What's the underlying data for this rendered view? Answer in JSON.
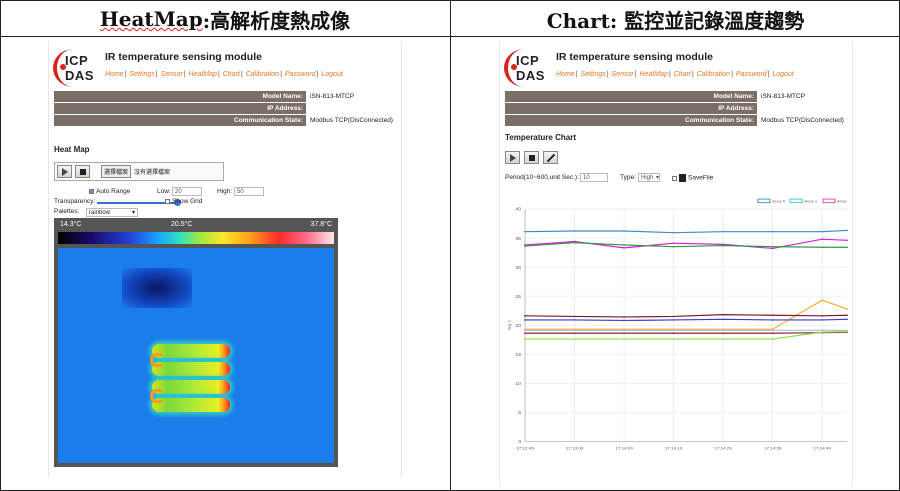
{
  "captions": {
    "left_prefix": "HeatMap",
    "left_suffix": ":高解析度熱成像",
    "right": "Chart:  監控並記錄溫度趨勢"
  },
  "common": {
    "logo_line1": "ICP",
    "logo_line2": "DAS",
    "module_title": "IR temperature sensing module",
    "nav": [
      "Home",
      "Settings",
      "Sensor",
      "HeatMap",
      "Chart",
      "Calibration",
      "Password",
      "Logout"
    ],
    "nav_sep": "|",
    "info": [
      {
        "key": "Model Name:",
        "value": "iSN-813-MTCP"
      },
      {
        "key": "IP Address:",
        "value": ""
      },
      {
        "key": "Communication State:",
        "value": "Modbus TCP(DisConnected)"
      }
    ]
  },
  "heatmap": {
    "section_title": "Heat Map",
    "file_button": "選擇檔案",
    "file_status": "沒有選擇檔案",
    "auto_range_label": "Auto Range",
    "auto_range_checked": true,
    "low_label": "Low:",
    "low_value": "20",
    "high_label": "High:",
    "high_value": "50",
    "transparency_label": "Transparency:",
    "show_grid_label": "Show Grid",
    "palettes_label": "Palettes:",
    "palette_value": "rainbow",
    "scale_min": "14.3°C",
    "scale_mid": "20.5°C",
    "scale_max": "37.8°C",
    "icons": [
      "play-icon",
      "stop-icon"
    ]
  },
  "chart_page": {
    "section_title": "Temperature Chart",
    "period_label": "Period(10~600,unit Sec.):",
    "period_value": "10",
    "type_label": "Type:",
    "type_value": "High",
    "savefile_label": "SaveFile",
    "icons": [
      "play-icon",
      "stop-icon",
      "brush-icon"
    ]
  },
  "chart_data": {
    "type": "line",
    "ylabel": "deg C",
    "ylim": [
      0,
      40
    ],
    "yticks": [
      0,
      5,
      10,
      15,
      20,
      25,
      30,
      35,
      40
    ],
    "x": [
      "17:12:49",
      "17:13:09",
      "17:14:09",
      "17:14:19",
      "17:14:29",
      "17:14:39",
      "17:14:49"
    ],
    "xtick_positions": [
      0,
      1,
      2,
      3,
      4,
      5,
      6
    ],
    "legend_placement": "top-right",
    "legend": [
      "Area 0",
      "Area 1",
      "Area"
    ],
    "series": [
      {
        "color": "#3a8ad0",
        "points": [
          [
            0,
            36.1
          ],
          [
            1,
            36.2
          ],
          [
            2,
            36.2
          ],
          [
            3,
            35.9
          ],
          [
            4,
            36.1
          ],
          [
            5,
            36.1
          ],
          [
            6,
            36.1
          ],
          [
            6.5,
            36.3
          ]
        ]
      },
      {
        "color": "#d020d8",
        "points": [
          [
            0,
            33.8
          ],
          [
            1,
            34.4
          ],
          [
            2,
            33.3
          ],
          [
            3,
            34.1
          ],
          [
            4,
            33.9
          ],
          [
            5,
            33.2
          ],
          [
            6,
            34.8
          ],
          [
            6.5,
            34.6
          ]
        ]
      },
      {
        "color": "#2a9a3a",
        "points": [
          [
            0,
            33.6
          ],
          [
            1,
            34.2
          ],
          [
            2,
            33.8
          ],
          [
            3,
            33.5
          ],
          [
            4,
            33.7
          ],
          [
            5,
            33.5
          ],
          [
            6,
            33.4
          ],
          [
            6.5,
            33.4
          ]
        ]
      },
      {
        "color": "#f0b030",
        "points": [
          [
            0,
            19.3
          ],
          [
            1,
            19.3
          ],
          [
            2,
            19.3
          ],
          [
            3,
            19.3
          ],
          [
            4,
            19.3
          ],
          [
            5,
            19.3
          ],
          [
            6,
            24.3
          ],
          [
            6.5,
            22.8
          ]
        ]
      },
      {
        "color": "#7a1a2a",
        "points": [
          [
            0,
            21.6
          ],
          [
            1,
            21.5
          ],
          [
            2,
            21.4
          ],
          [
            3,
            21.5
          ],
          [
            4,
            21.8
          ],
          [
            5,
            21.7
          ],
          [
            6,
            21.6
          ],
          [
            6.5,
            21.7
          ]
        ]
      },
      {
        "color": "#3a3ad0",
        "points": [
          [
            0,
            20.9
          ],
          [
            1,
            20.9
          ],
          [
            2,
            20.8
          ],
          [
            3,
            20.9
          ],
          [
            4,
            21.0
          ],
          [
            5,
            20.9
          ],
          [
            6,
            20.9
          ],
          [
            6.5,
            21.0
          ]
        ]
      },
      {
        "color": "#b4b8d8",
        "points": [
          [
            0,
            19.1
          ],
          [
            1,
            19.1
          ],
          [
            2,
            19.1
          ],
          [
            3,
            19.1
          ],
          [
            4,
            19.1
          ],
          [
            5,
            19.1
          ],
          [
            6,
            19.1
          ],
          [
            6.5,
            19.1
          ]
        ]
      },
      {
        "color": "#c8c8c8",
        "points": [
          [
            0,
            18.7
          ],
          [
            1,
            18.7
          ],
          [
            2,
            18.7
          ],
          [
            3,
            18.7
          ],
          [
            4,
            18.7
          ],
          [
            5,
            18.7
          ],
          [
            6,
            18.7
          ],
          [
            6.5,
            18.7
          ]
        ]
      },
      {
        "color": "#a02a40",
        "points": [
          [
            0,
            18.6
          ],
          [
            1,
            18.6
          ],
          [
            2,
            18.6
          ],
          [
            3,
            18.6
          ],
          [
            4,
            18.6
          ],
          [
            5,
            18.6
          ],
          [
            6,
            18.7
          ],
          [
            6.5,
            18.8
          ]
        ]
      },
      {
        "color": "#8ae040",
        "points": [
          [
            0,
            17.6
          ],
          [
            1,
            17.6
          ],
          [
            2,
            17.6
          ],
          [
            3,
            17.6
          ],
          [
            4,
            17.6
          ],
          [
            5,
            17.6
          ],
          [
            6,
            18.8
          ],
          [
            6.5,
            18.9
          ]
        ]
      }
    ]
  }
}
